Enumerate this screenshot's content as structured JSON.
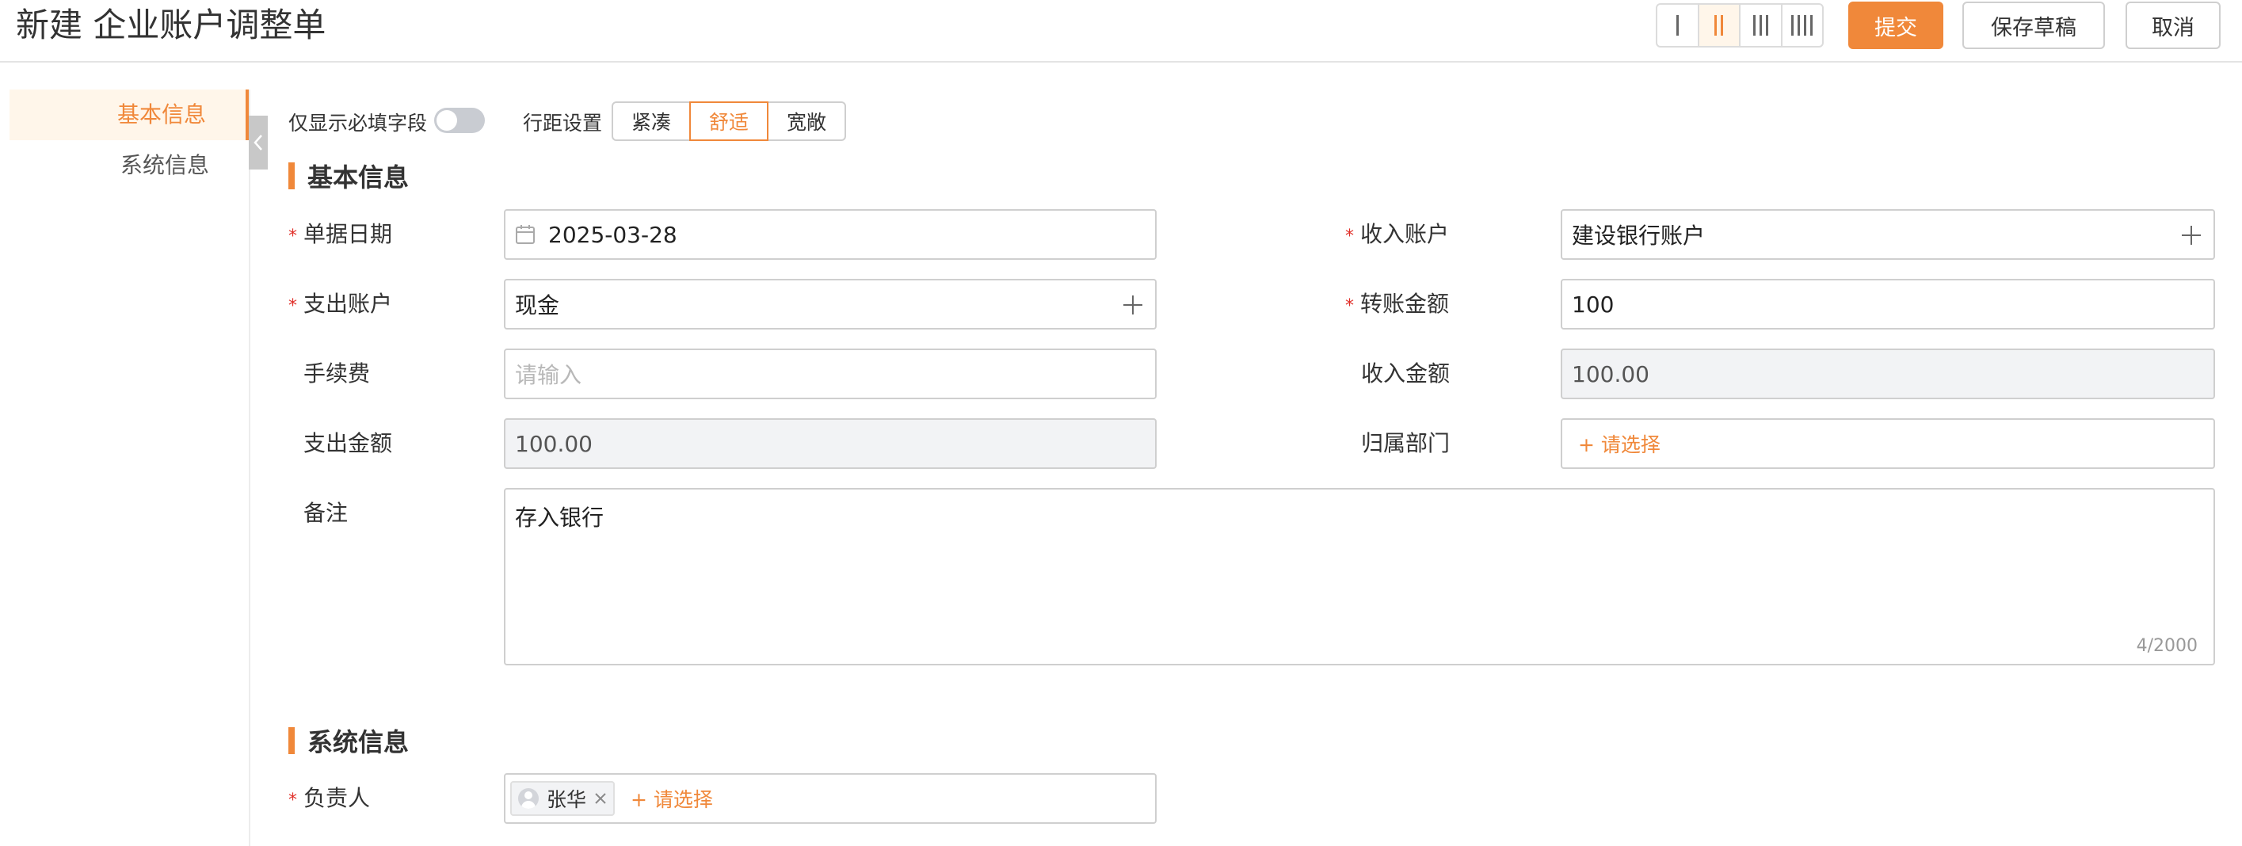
{
  "header": {
    "title": "新建 企业账户调整单",
    "column_layout_options": [
      "one-column",
      "two-column",
      "three-column",
      "four-column"
    ],
    "active_column_layout": "two-column",
    "submit_label": "提交",
    "save_draft_label": "保存草稿",
    "cancel_label": "取消"
  },
  "nav": {
    "items": [
      {
        "label": "基本信息",
        "active": true
      },
      {
        "label": "系统信息",
        "active": false
      }
    ]
  },
  "toolbar": {
    "required_only_label": "仅显示必填字段",
    "required_only_on": false,
    "density_label": "行距设置",
    "density_options": [
      "紧凑",
      "舒适",
      "宽敞"
    ],
    "density_selected": "舒适"
  },
  "basic_section": {
    "title": "基本信息",
    "fields": {
      "date": {
        "label": "单据日期",
        "value": "2025-03-28",
        "required": true
      },
      "income_account": {
        "label": "收入账户",
        "value": "建设银行账户",
        "required": true
      },
      "expense_account": {
        "label": "支出账户",
        "value": "现金",
        "required": true
      },
      "transfer_amount": {
        "label": "转账金额",
        "value": "100",
        "required": true
      },
      "fee": {
        "label": "手续费",
        "placeholder": "请输入",
        "value": ""
      },
      "income_amount": {
        "label": "收入金额",
        "value": "100.00"
      },
      "expense_amount": {
        "label": "支出金额",
        "value": "100.00"
      },
      "department": {
        "label": "归属部门",
        "select_label": "+ 请选择"
      },
      "remark": {
        "label": "备注",
        "value": "存入银行",
        "counter": "4/2000"
      }
    }
  },
  "system_section": {
    "title": "系统信息",
    "owner": {
      "label": "负责人",
      "required": true,
      "tags": [
        "张华"
      ],
      "select_label": "+ 请选择"
    }
  },
  "colors": {
    "accent": "#f0883a",
    "required": "#e0302a",
    "disabled_bg": "#f2f3f5"
  }
}
